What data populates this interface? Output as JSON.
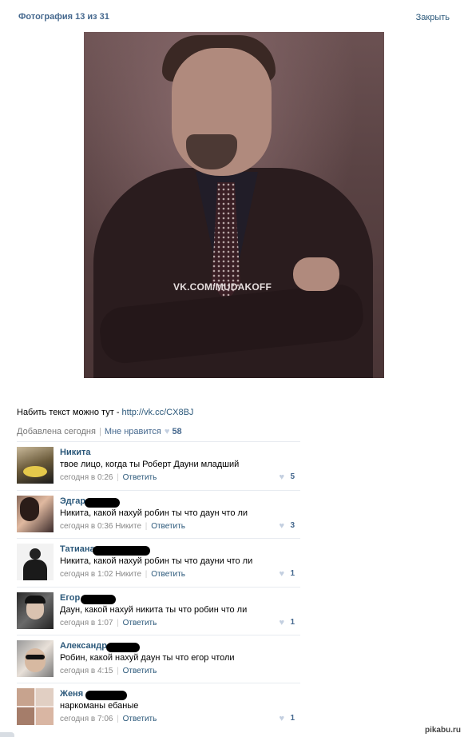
{
  "header": {
    "title": "Фотография 13 из 31",
    "close_label": "Закрыть"
  },
  "photo": {
    "watermark": "VK.COM/MUDAKOFF"
  },
  "description": {
    "text": "Набить текст можно тут - ",
    "link": "http://vk.cc/CX8BJ"
  },
  "meta": {
    "added": "Добавлена сегодня",
    "like_label": "Мне нравится",
    "like_count": "58"
  },
  "comments": [
    {
      "name": "Никита",
      "text": "твое лицо, когда ты Роберт Дауни младший",
      "time": "сегодня в 0:26",
      "reply_to": "",
      "reply_label": "Ответить",
      "likes": "5"
    },
    {
      "name": "Эдгар",
      "text": "Никита, какой нахуй робин ты что даун что ли",
      "time": "сегодня в 0:36",
      "reply_to": "Никите",
      "reply_label": "Ответить",
      "likes": "3"
    },
    {
      "name": "Татиана",
      "text": "Никита, какой нахуй робин ты что дауни что ли",
      "time": "сегодня в 1:02",
      "reply_to": "Никите",
      "reply_label": "Ответить",
      "likes": "1"
    },
    {
      "name": "Егор",
      "text": "Даун, какой нахуй никита ты что робин что ли",
      "time": "сегодня в 1:07",
      "reply_to": "",
      "reply_label": "Ответить",
      "likes": "1"
    },
    {
      "name": "Александр",
      "text": "Робин, какой нахуй даун ты что егор чтоли",
      "time": "сегодня в 4:15",
      "reply_to": "",
      "reply_label": "Ответить",
      "likes": ""
    },
    {
      "name": "Женя",
      "text": "наркоманы ебаные",
      "time": "сегодня в 7:06",
      "reply_to": "",
      "reply_label": "Ответить",
      "likes": "1"
    }
  ],
  "footer": {
    "logo": "pikabu.ru"
  }
}
